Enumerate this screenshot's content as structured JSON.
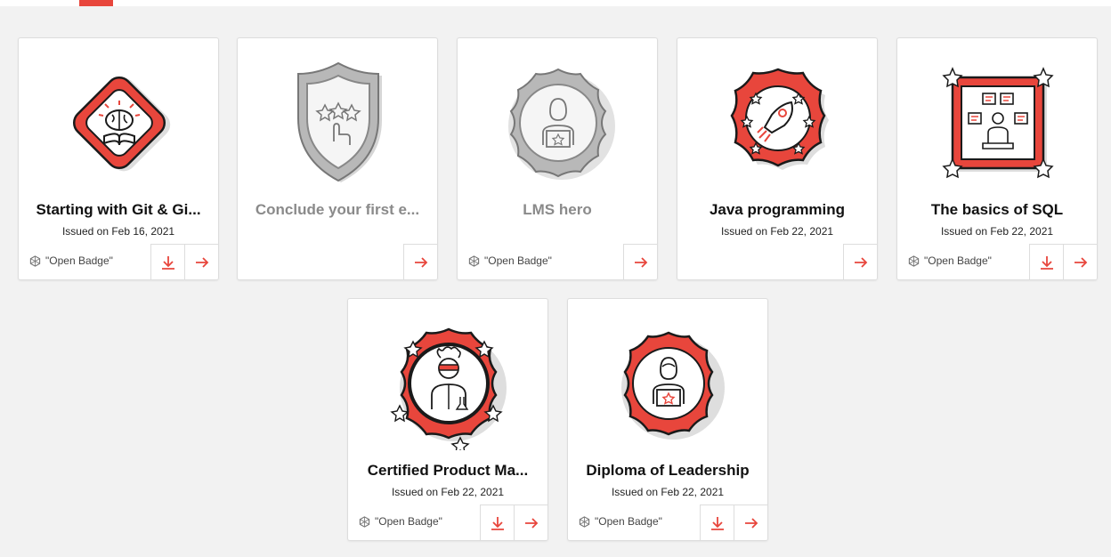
{
  "colors": {
    "accent": "#e8463c",
    "inactive_gray": "#9e9e9e",
    "ink": "#1a1a1a"
  },
  "cards": [
    {
      "title": "Starting with Git & Gi...",
      "issued": "Issued on Feb 16, 2021",
      "badge_label": "\"Open Badge\"",
      "icon": "brain-book-badge-icon",
      "state": "earned"
    },
    {
      "title": "Conclude your first e...",
      "issued": "",
      "badge_label": "",
      "icon": "shield-stars-hand-badge-icon",
      "state": "locked"
    },
    {
      "title": "LMS hero",
      "issued": "",
      "badge_label": "\"Open Badge\"",
      "icon": "person-laptop-badge-icon",
      "state": "locked"
    },
    {
      "title": "Java programming",
      "issued": "Issued on Feb 22, 2021",
      "badge_label": "",
      "icon": "rocket-badge-icon",
      "state": "earned"
    },
    {
      "title": "The basics of SQL",
      "issued": "Issued on Feb 22, 2021",
      "badge_label": "\"Open Badge\"",
      "icon": "presenter-boards-badge-icon",
      "state": "earned"
    },
    {
      "title": "Certified Product Ma...",
      "issued": "Issued on Feb 22, 2021",
      "badge_label": "\"Open Badge\"",
      "icon": "scientist-badge-icon",
      "state": "earned"
    },
    {
      "title": "Diploma of Leadership",
      "issued": "Issued on Feb 22, 2021",
      "badge_label": "\"Open Badge\"",
      "icon": "leader-laptop-badge-icon",
      "state": "earned"
    }
  ]
}
